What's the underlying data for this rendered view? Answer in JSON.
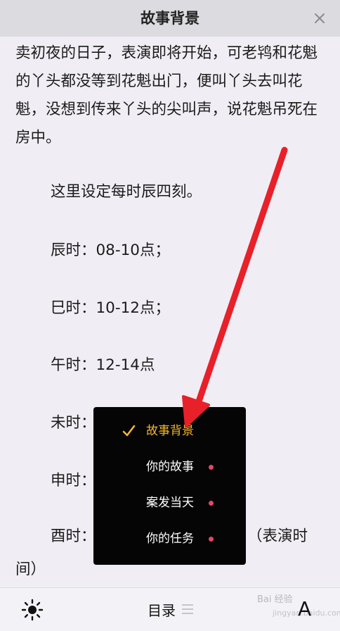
{
  "header": {
    "title": "故事背景"
  },
  "content": {
    "intro": "卖初夜的日子，表演即将开始，可老鸨和花魁的丫头都没等到花魁出门，便叫丫头去叫花魁，没想到传来丫头的尖叫声，说花魁吊死在房中。",
    "note": "这里设定每时辰四刻。",
    "times": {
      "chen": "辰时：08-10点；",
      "si": "巳时：10-12点；",
      "wu": "午时：12-14点",
      "wei": "未时：",
      "shen": "申时：",
      "you_left": "酉时：",
      "you_right": "（表演时",
      "you_tail": "间）"
    }
  },
  "menu": {
    "items": [
      {
        "label": "故事背景",
        "active": true
      },
      {
        "label": "你的故事",
        "active": false
      },
      {
        "label": "案发当天",
        "active": false
      },
      {
        "label": "你的任务",
        "active": false
      }
    ],
    "active_color": "#f5b62a",
    "dot_color": "#e8446a"
  },
  "footer": {
    "toc_label": "目录",
    "font_label": "A",
    "watermark": "Bai 经验",
    "watermark_sub": "jingyan.baidu.com"
  },
  "annotation": {
    "arrow_color": "#e8202a"
  }
}
